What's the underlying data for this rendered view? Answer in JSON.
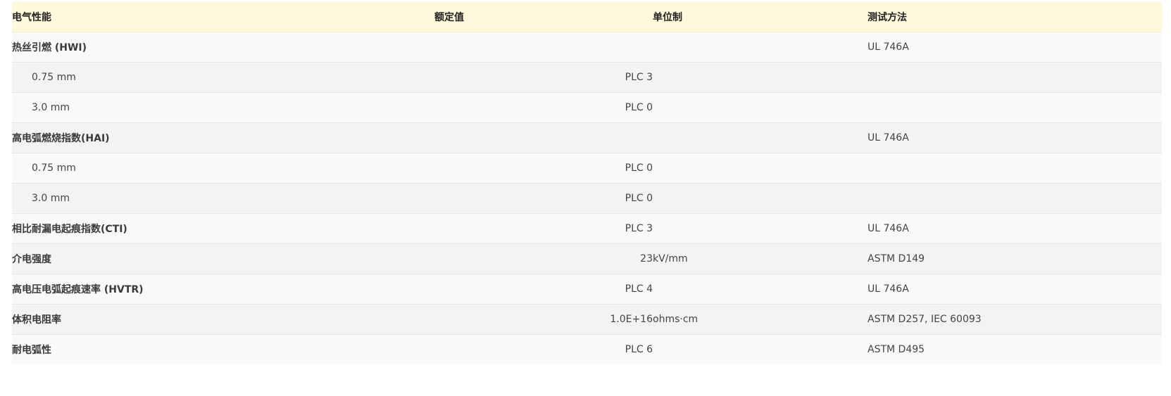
{
  "header": {
    "property": "电气性能",
    "value": "额定值",
    "unit": "单位制",
    "method": "测试方法"
  },
  "rows": [
    {
      "property": "热丝引燃 (HWI)",
      "value": "",
      "unit": "",
      "method": "UL 746A",
      "level": "main"
    },
    {
      "property": "0.75 mm",
      "value": "PLC 3",
      "unit": "",
      "method": "",
      "level": "sub"
    },
    {
      "property": "3.0 mm",
      "value": "PLC 0",
      "unit": "",
      "method": "",
      "level": "sub"
    },
    {
      "property": "高电弧燃烧指数(HAI)",
      "value": "",
      "unit": "",
      "method": "UL 746A",
      "level": "main"
    },
    {
      "property": "0.75 mm",
      "value": "PLC 0",
      "unit": "",
      "method": "",
      "level": "sub"
    },
    {
      "property": "3.0 mm",
      "value": "PLC 0",
      "unit": "",
      "method": "",
      "level": "sub"
    },
    {
      "property": "相比耐漏电起痕指数(CTI)",
      "value": "PLC 3",
      "unit": "",
      "method": "UL 746A",
      "level": "main"
    },
    {
      "property": "介电强度",
      "value": "23",
      "unit": "kV/mm",
      "method": "ASTM D149",
      "level": "main"
    },
    {
      "property": "高电压电弧起痕速率 (HVTR)",
      "value": "PLC 4",
      "unit": "",
      "method": "UL 746A",
      "level": "main"
    },
    {
      "property": "体积电阻率",
      "value": "1.0E+16",
      "unit": "ohms·cm",
      "method": "ASTM D257, IEC 60093",
      "level": "main"
    },
    {
      "property": "耐电弧性",
      "value": "PLC 6",
      "unit": "",
      "method": "ASTM D495",
      "level": "main"
    }
  ]
}
